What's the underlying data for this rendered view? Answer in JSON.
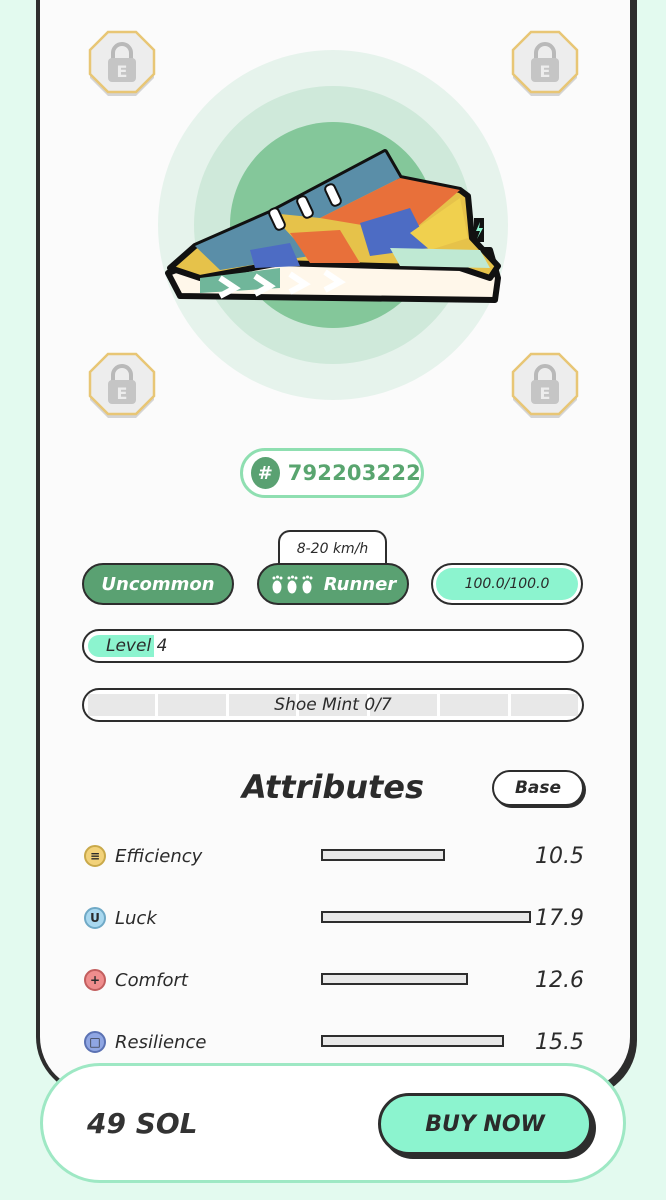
{
  "sneaker": {
    "id_prefix": "#",
    "id": "792203222",
    "rarity": "Uncommon",
    "type": "Runner",
    "speed_range": "8-20 km/h",
    "durability": "100.0/100.0",
    "durability_fraction": 1.0,
    "level_label": "Level",
    "level_value": "4",
    "mint_label": "Shoe Mint 0/7",
    "mint_fraction": 0.0
  },
  "lock_sockets": [
    {
      "icon": "lock-icon",
      "letter": "E"
    },
    {
      "icon": "lock-icon",
      "letter": "E"
    },
    {
      "icon": "lock-icon",
      "letter": "E"
    },
    {
      "icon": "lock-icon",
      "letter": "E"
    }
  ],
  "attributes": {
    "title": "Attributes",
    "toggle_label": "Base",
    "items": [
      {
        "name": "Efficiency",
        "value": "10.5",
        "icon": "efficiency-icon",
        "color": "#f2d27a",
        "fraction": 0.59
      },
      {
        "name": "Luck",
        "value": "17.9",
        "icon": "luck-icon",
        "color": "#a9d8ef",
        "fraction": 1.0
      },
      {
        "name": "Comfort",
        "value": "12.6",
        "icon": "comfort-icon",
        "color": "#ef8d8d",
        "fraction": 0.7
      },
      {
        "name": "Resilience",
        "value": "15.5",
        "icon": "resilience-icon",
        "color": "#8fa6e3",
        "fraction": 0.87
      }
    ]
  },
  "footer": {
    "price": "49 SOL",
    "buy_label": "BUY NOW"
  },
  "colors": {
    "accent_green": "#5aa172",
    "mint": "#8cf4cf",
    "outline": "#2d2d2d"
  }
}
